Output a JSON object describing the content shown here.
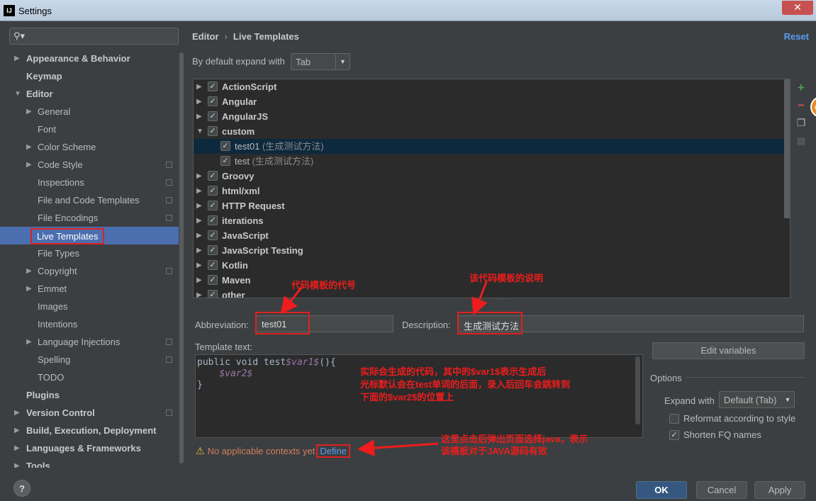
{
  "window": {
    "title": "Settings",
    "app_icon": "IJ",
    "close_symbol": "✕"
  },
  "sidebar": {
    "search_placeholder": "",
    "items": [
      {
        "label": "Appearance & Behavior"
      },
      {
        "label": "Keymap"
      },
      {
        "label": "Editor"
      },
      {
        "label": "General"
      },
      {
        "label": "Font"
      },
      {
        "label": "Color Scheme"
      },
      {
        "label": "Code Style"
      },
      {
        "label": "Inspections"
      },
      {
        "label": "File and Code Templates"
      },
      {
        "label": "File Encodings"
      },
      {
        "label": "Live Templates"
      },
      {
        "label": "File Types"
      },
      {
        "label": "Copyright"
      },
      {
        "label": "Emmet"
      },
      {
        "label": "Images"
      },
      {
        "label": "Intentions"
      },
      {
        "label": "Language Injections"
      },
      {
        "label": "Spelling"
      },
      {
        "label": "TODO"
      },
      {
        "label": "Plugins"
      },
      {
        "label": "Version Control"
      },
      {
        "label": "Build, Execution, Deployment"
      },
      {
        "label": "Languages & Frameworks"
      },
      {
        "label": "Tools"
      }
    ],
    "help_label": "?"
  },
  "header": {
    "breadcrumb_parent": "Editor",
    "breadcrumb_sep": "›",
    "breadcrumb_current": "Live Templates",
    "reset": "Reset"
  },
  "expand": {
    "label": "By default expand with",
    "value": "Tab"
  },
  "templates": [
    {
      "name": "ActionScript",
      "desc": ""
    },
    {
      "name": "Angular",
      "desc": ""
    },
    {
      "name": "AngularJS",
      "desc": ""
    },
    {
      "name": "custom",
      "desc": ""
    },
    {
      "name": "test01",
      "desc": " (生成测试方法)"
    },
    {
      "name": "test",
      "desc": " (生成测试方法)"
    },
    {
      "name": "Groovy",
      "desc": ""
    },
    {
      "name": "html/xml",
      "desc": ""
    },
    {
      "name": "HTTP Request",
      "desc": ""
    },
    {
      "name": "iterations",
      "desc": ""
    },
    {
      "name": "JavaScript",
      "desc": ""
    },
    {
      "name": "JavaScript Testing",
      "desc": ""
    },
    {
      "name": "Kotlin",
      "desc": ""
    },
    {
      "name": "Maven",
      "desc": ""
    },
    {
      "name": "other",
      "desc": ""
    }
  ],
  "toolbar": {
    "add": "+",
    "remove": "−",
    "copy": "❐",
    "misc": "▤",
    "orange_badge": "6"
  },
  "abbreviation": {
    "label": "Abbreviation:",
    "value": "test01"
  },
  "description": {
    "label": "Description:",
    "value": "生成测试方法"
  },
  "template_text": {
    "label": "Template text:",
    "line1_pre": "public void test",
    "line1_var": "$var1$",
    "line1_post": "(){",
    "line2_indent": "    ",
    "line2_var": "$var2$",
    "line3": "}"
  },
  "edit_variables": "Edit variables",
  "options": {
    "title": "Options",
    "expand_with_label": "Expand with",
    "expand_with_value": "Default (Tab)",
    "reformat_label": "Reformat according to style",
    "reformat_checked": false,
    "shorten_label": "Shorten FQ names",
    "shorten_checked": true
  },
  "warning": {
    "icon": "⚠",
    "text": "No applicable contexts yet",
    "define": "Define"
  },
  "buttons": {
    "ok": "OK",
    "cancel": "Cancel",
    "apply": "Apply"
  },
  "annotations": {
    "abbr_note": "代码模板的代号",
    "desc_note": "该代码模板的说明",
    "code_note_1": "实际会生成的代码，其中的$var1$表示生成后",
    "code_note_2": "光标默认会在test单词的后面，录入后回车会跳转到",
    "code_note_3": "下面的$var2$的位置上",
    "define_note_1": "这里点击后弹出页面选择java，表示",
    "define_note_2": "该模板对于JAVA源码有效"
  },
  "colors": {
    "selection": "#4b6eaf",
    "annotation_red": "#ee1c1c",
    "link": "#589df6",
    "ok_button": "#365880"
  }
}
